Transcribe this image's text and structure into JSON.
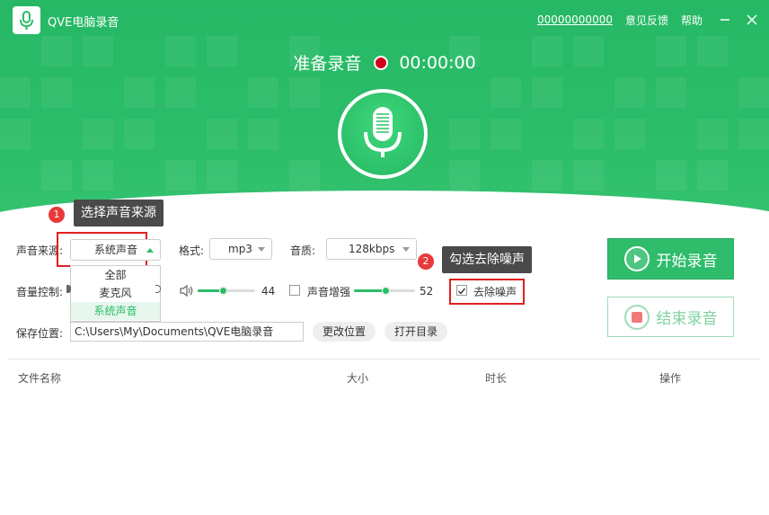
{
  "app": {
    "title": "QVE电脑录音"
  },
  "topbar": {
    "account": "00000000000",
    "feedback": "意见反馈",
    "help": "帮助"
  },
  "status": {
    "label": "准备录音",
    "timer": "00:00:00"
  },
  "tips": {
    "source": {
      "num": "1",
      "text": "选择声音来源"
    },
    "noise": {
      "num": "2",
      "text": "勾选去除噪声"
    }
  },
  "form": {
    "source_label": "声音来源:",
    "source_value": "系统声音",
    "source_options": [
      "全部",
      "麦克风",
      "系统声音"
    ],
    "format_label": "格式:",
    "format_value": "mp3",
    "quality_label": "音质:",
    "quality_value": "128kbps",
    "volume_label": "音量控制:",
    "volume_value": "44",
    "volume_level": 0.44,
    "boost_label": "声音增强",
    "boost_value": "52",
    "boost_level": 0.52,
    "denoise_label": "去除噪声",
    "denoise_checked": true,
    "save_label": "保存位置:",
    "save_path": "C:\\Users\\My\\Documents\\QVE电脑录音",
    "change_location": "更改位置",
    "open_folder": "打开目录"
  },
  "buttons": {
    "start": "开始录音",
    "stop": "结束录音"
  },
  "table": {
    "columns": [
      "文件名称",
      "大小",
      "时长",
      "操作"
    ]
  },
  "colors": {
    "brand": "#2bbd68",
    "record": "#d0021b",
    "highlight": "#e02020",
    "tip_bg": "#4a4a4a"
  }
}
